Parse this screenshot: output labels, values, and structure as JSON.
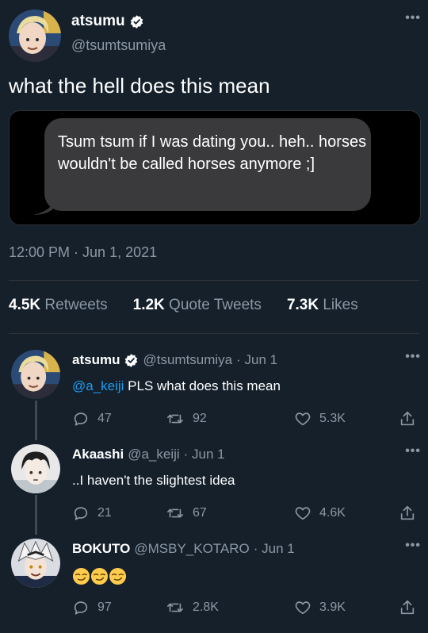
{
  "main": {
    "name": "atsumu",
    "handle": "@tsumtsumiya",
    "text": "what the hell does this mean",
    "message": "Tsum tsum if I was dating you.. heh.. horses wouldn't be called horses anymore ;]",
    "timestamp": "12:00 PM · Jun 1, 2021",
    "stats": {
      "retweets_count": "4.5K",
      "retweets_label": "Retweets",
      "quotes_count": "1.2K",
      "quotes_label": "Quote Tweets",
      "likes_count": "7.3K",
      "likes_label": "Likes"
    },
    "more_glyph": "•••"
  },
  "replies": [
    {
      "name": "atsumu",
      "handle": "@tsumtsumiya",
      "date": "· Jun 1",
      "mention": "@a_keiji",
      "text": " PLS what does this mean",
      "replies": "47",
      "retweets": "92",
      "likes": "5.3K",
      "verified": true
    },
    {
      "name": "Akaashi",
      "handle": "@a_keiji",
      "date": "· Jun 1",
      "text": "..I haven't the slightest idea",
      "replies": "21",
      "retweets": "67",
      "likes": "4.6K",
      "verified": false
    },
    {
      "name": "BOKUTO",
      "handle": "@MSBY_KOTARO",
      "date": "· Jun 1",
      "text": "",
      "emoji": [
        "smirking-face",
        "smirking-face",
        "smirking-face"
      ],
      "replies": "97",
      "retweets": "2.8K",
      "likes": "3.9K",
      "verified": false
    }
  ],
  "colors": {
    "background": "#15202b",
    "muted": "#8b98a5",
    "accent": "#1d9bf0",
    "divider": "#2f3336"
  },
  "icons": [
    "verified-badge-icon",
    "more-options-icon",
    "reply-icon",
    "retweet-icon",
    "like-icon",
    "share-icon"
  ]
}
